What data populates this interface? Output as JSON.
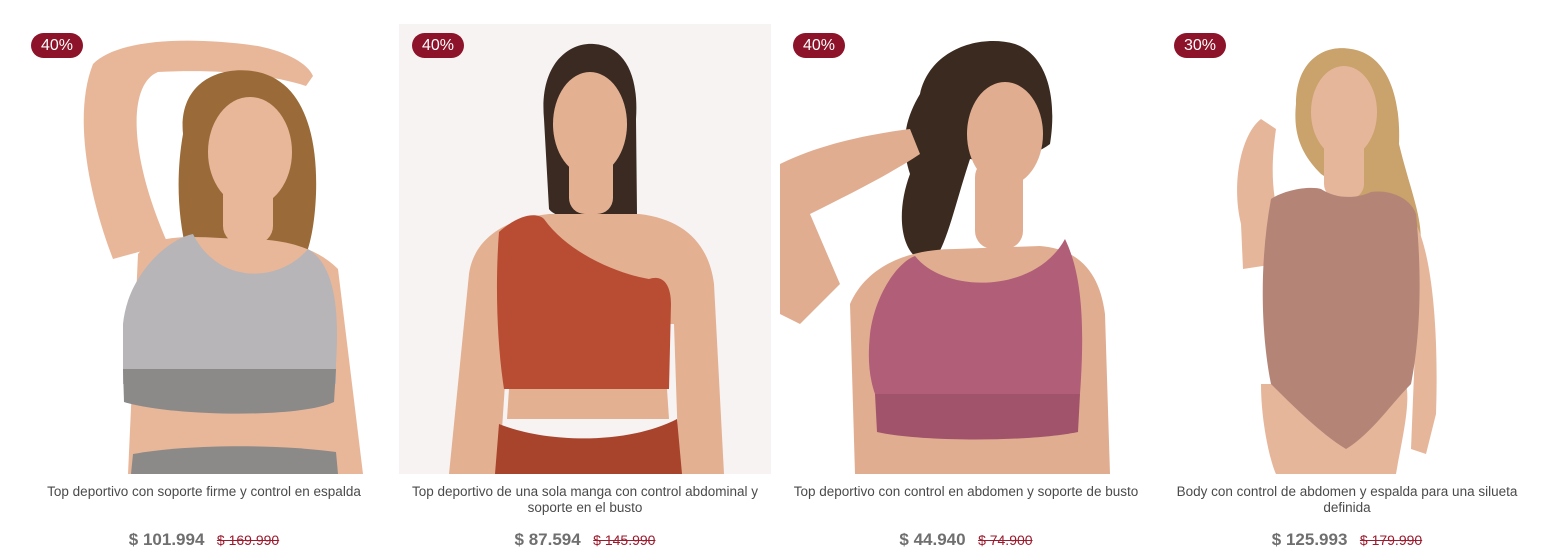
{
  "products": [
    {
      "discount": "40%",
      "name": "Top deportivo con soporte firme y control en espalda",
      "price": "$ 101.994",
      "old_price": "$ 169.990",
      "image_label": "Modelo con top deportivo estampado gris",
      "colors": {
        "garment": "#b7b5b8",
        "band": "#8b8a88",
        "hair": "#9a6b38",
        "skin": "#e8b79a"
      }
    },
    {
      "discount": "40%",
      "name": "Top deportivo de una sola manga con control abdominal y soporte en el busto",
      "price": "$ 87.594",
      "old_price": "$ 145.990",
      "image_label": "Modelo con top de una manga color terracota",
      "colors": {
        "garment": "#b84d33",
        "band": "#a8432c",
        "hair": "#3a2a22",
        "skin": "#e3b092"
      }
    },
    {
      "discount": "40%",
      "name": "Top deportivo con control en abdomen y soporte de busto",
      "price": "$ 44.940",
      "old_price": "$ 74.900",
      "image_label": "Modelo con top deportivo color malva",
      "colors": {
        "garment": "#b15e78",
        "band": "#a1536c",
        "hair": "#3b2a20",
        "skin": "#e1ad90"
      }
    },
    {
      "discount": "30%",
      "name": "Body con control de abdomen y espalda para una silueta definida",
      "price": "$ 125.993",
      "old_price": "$ 179.990",
      "image_label": "Modelo con body moldeador color palo de rosa",
      "colors": {
        "garment": "#b48576",
        "band": "#a77a6c",
        "hair": "#c9a26c",
        "skin": "#e6b69b"
      }
    }
  ]
}
